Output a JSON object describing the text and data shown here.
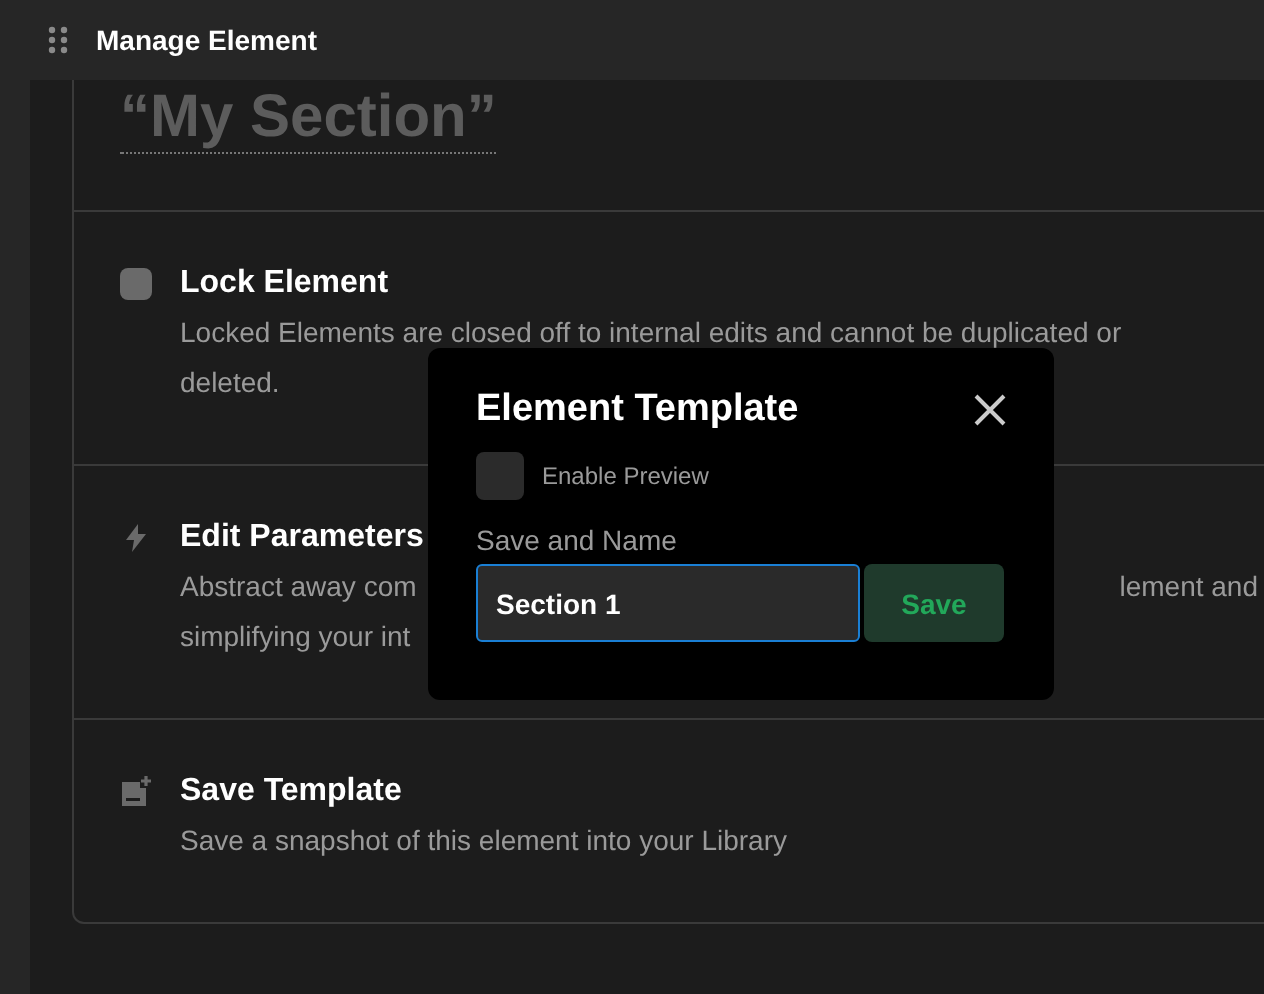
{
  "header": {
    "title": "Manage Element"
  },
  "section_name": "“My Section”",
  "sections": [
    {
      "kind": "checkbox",
      "checked": false,
      "title": "Lock Element",
      "lines": [
        [
          "Locked Elements are closed off to internal edits and cannot be duplicated or"
        ],
        [
          "deleted."
        ]
      ]
    },
    {
      "kind": "bolt",
      "title": "Edit Parameters",
      "lines": [
        [
          "Abstract away com",
          "lement and"
        ],
        [
          "simplifying your int"
        ]
      ]
    },
    {
      "kind": "template",
      "title": "Save Template",
      "lines": [
        [
          "Save a snapshot of this element into your Library"
        ]
      ]
    }
  ],
  "dialog": {
    "title": "Element Template",
    "preview": {
      "label": "Enable Preview",
      "checked": false
    },
    "name_label": "Save and Name",
    "name_value": "Section 1",
    "save_button": "Save"
  }
}
